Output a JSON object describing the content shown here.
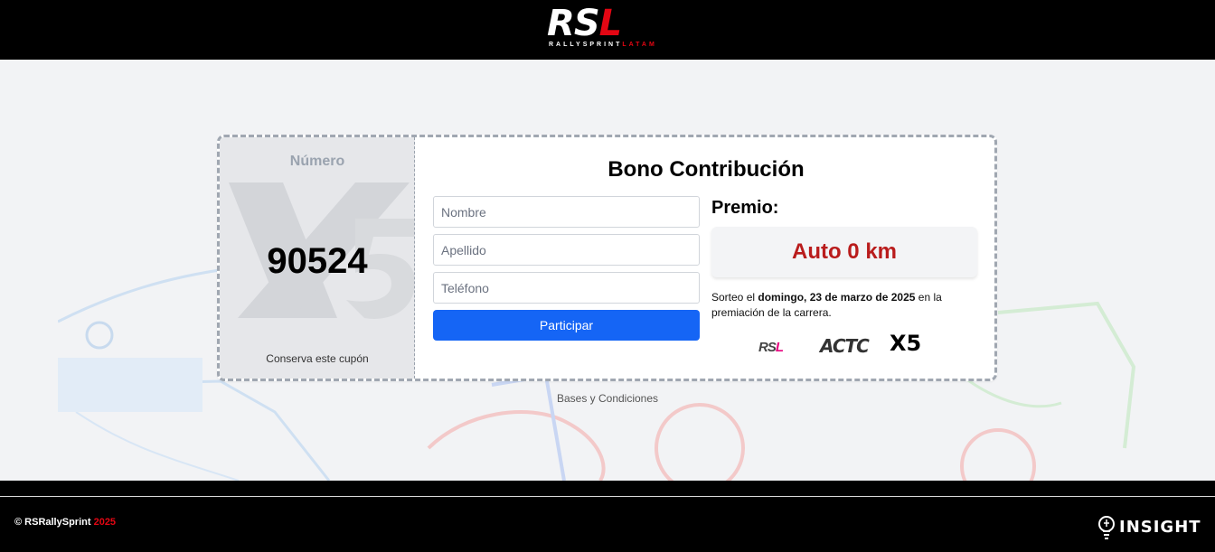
{
  "header": {
    "logo_letters": {
      "r": "R",
      "s": "S",
      "l": "L"
    },
    "logo_sub_white": "RALLYSPRINT",
    "logo_sub_red": "LATAM"
  },
  "ticket": {
    "stub": {
      "label": "Número",
      "number": "90524",
      "footer": "Conserva este cupón"
    },
    "form": {
      "title": "Bono Contribución",
      "name_placeholder": "Nombre",
      "lastname_placeholder": "Apellido",
      "phone_placeholder": "Teléfono",
      "submit_label": "Participar"
    },
    "prize": {
      "label": "Premio:",
      "value": "Auto 0 km",
      "draw_prefix": "Sorteo el ",
      "draw_date": "domingo, 23 de marzo de 2025",
      "draw_suffix": " en la premiación de la carrera."
    },
    "sponsors": {
      "rsl": {
        "rs": "RS",
        "l": "L"
      },
      "actc": "ACTC",
      "x5": "X5"
    }
  },
  "terms_link": "Bases y Condiciones",
  "footer": {
    "copyright_prefix": "© RSRallySprint ",
    "year": "2025",
    "brand": "INSIGHT"
  },
  "colors": {
    "brand_red": "#e30613",
    "primary_button": "#1565f5",
    "prize_red": "#b91c1c",
    "sponsor_pink": "#e6007e"
  }
}
